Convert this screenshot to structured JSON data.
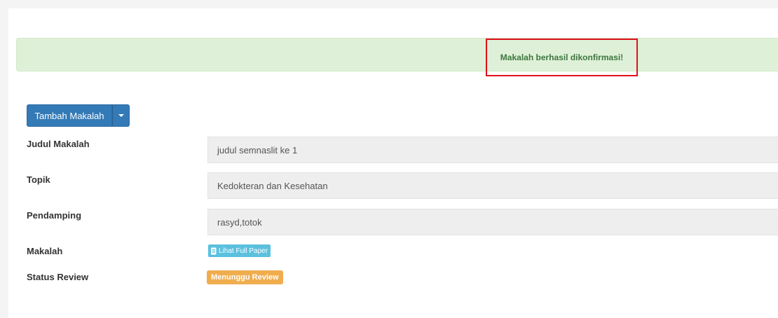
{
  "alert": {
    "message": "Makalah berhasil dikonfirmasi!"
  },
  "toolbar": {
    "add_paper_label": "Tambah Makalah",
    "dropdown_icon": "caret-down-icon"
  },
  "details": {
    "title_label": "Judul Makalah",
    "title_value": "judul semnaslit ke 1",
    "topic_label": "Topik",
    "topic_value": "Kedokteran dan Kesehatan",
    "companion_label": "Pendamping",
    "companion_value": "rasyd,totok",
    "paper_label": "Makalah",
    "paper_link_label": "Lihat Full Paper",
    "paper_link_icon": "file-icon",
    "status_label": "Status Review",
    "status_value": "Menunggu Review"
  },
  "colors": {
    "primary": "#337ab7",
    "success_bg": "#dff0d8",
    "success_text": "#3c763d",
    "highlight": "#e0101b",
    "info": "#5bc0de",
    "warning": "#f0ad4e"
  }
}
